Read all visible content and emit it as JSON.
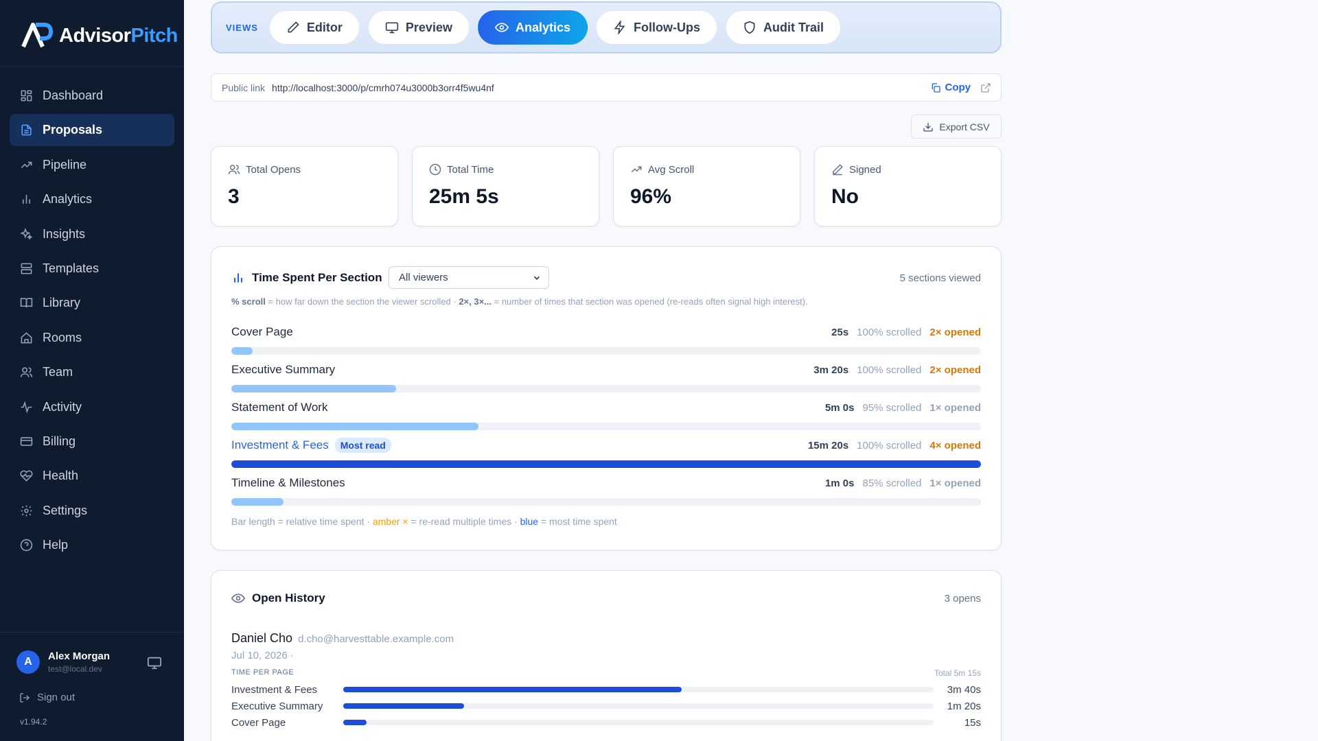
{
  "app": {
    "name_part1": "Advisor",
    "name_part2": "Pitch",
    "brand_color": "#3b9cff",
    "accent_color": "#2563eb"
  },
  "sidebar": {
    "items": [
      {
        "label": "Dashboard",
        "icon": "grid-icon",
        "active": false
      },
      {
        "label": "Proposals",
        "icon": "document-icon",
        "active": true
      },
      {
        "label": "Pipeline",
        "icon": "trending-icon",
        "active": false
      },
      {
        "label": "Analytics",
        "icon": "bar-chart-icon",
        "active": false
      },
      {
        "label": "Insights",
        "icon": "sparkles-icon",
        "active": false
      },
      {
        "label": "Templates",
        "icon": "layout-icon",
        "active": false
      },
      {
        "label": "Library",
        "icon": "book-icon",
        "active": false
      },
      {
        "label": "Rooms",
        "icon": "home-icon",
        "active": false
      },
      {
        "label": "Team",
        "icon": "users-icon",
        "active": false
      },
      {
        "label": "Activity",
        "icon": "pulse-icon",
        "active": false
      },
      {
        "label": "Billing",
        "icon": "credit-card-icon",
        "active": false
      },
      {
        "label": "Health",
        "icon": "heart-pulse-icon",
        "active": false
      },
      {
        "label": "Settings",
        "icon": "gear-icon",
        "active": false
      },
      {
        "label": "Help",
        "icon": "help-circle-icon",
        "active": false
      }
    ],
    "user": {
      "initial": "A",
      "name": "Alex Morgan",
      "email": "test@local.dev"
    },
    "sign_out": "Sign out",
    "version": "v1.94.2"
  },
  "views": {
    "label": "VIEWS",
    "tabs": [
      {
        "label": "Editor",
        "icon": "pencil-icon",
        "active": false
      },
      {
        "label": "Preview",
        "icon": "monitor-icon",
        "active": false
      },
      {
        "label": "Analytics",
        "icon": "eye-icon",
        "active": true
      },
      {
        "label": "Follow-Ups",
        "icon": "bolt-icon",
        "active": false
      },
      {
        "label": "Audit Trail",
        "icon": "shield-icon",
        "active": false
      }
    ]
  },
  "public_link": {
    "label": "Public link",
    "url": "http://localhost:3000/p/cmrh074u3000b3orr4f5wu4nf",
    "copy": "Copy"
  },
  "export_csv": "Export CSV",
  "stats": [
    {
      "label": "Total Opens",
      "value": "3",
      "icon": "users-icon"
    },
    {
      "label": "Total Time",
      "value": "25m 5s",
      "icon": "clock-icon"
    },
    {
      "label": "Avg Scroll",
      "value": "96%",
      "icon": "trending-icon"
    },
    {
      "label": "Signed",
      "value": "No",
      "icon": "pen-icon"
    }
  ],
  "time_per_section": {
    "title": "Time Spent Per Section",
    "filter": "All viewers",
    "meta": "5 sections viewed",
    "legend_scroll_key": "% scroll",
    "legend_scroll_text": " = how far down the section the viewer scrolled · ",
    "legend_reads_key": "2×, 3×...",
    "legend_reads_text": " = number of times that section was opened (re-reads often signal high interest).",
    "sections": [
      {
        "name": "Cover Page",
        "time": "25s",
        "scroll": "100% scrolled",
        "opened": "2× opened",
        "reread": true,
        "most_read": false,
        "fraction": 0.028
      },
      {
        "name": "Executive Summary",
        "time": "3m 20s",
        "scroll": "100% scrolled",
        "opened": "2× opened",
        "reread": true,
        "most_read": false,
        "fraction": 0.22
      },
      {
        "name": "Statement of Work",
        "time": "5m 0s",
        "scroll": "95% scrolled",
        "opened": "1× opened",
        "reread": false,
        "most_read": false,
        "fraction": 0.33
      },
      {
        "name": "Investment & Fees",
        "time": "15m 20s",
        "scroll": "100% scrolled",
        "opened": "4× opened",
        "reread": true,
        "most_read": true,
        "badge": "Most read",
        "fraction": 1.0
      },
      {
        "name": "Timeline & Milestones",
        "time": "1m 0s",
        "scroll": "85% scrolled",
        "opened": "1× opened",
        "reread": false,
        "most_read": false,
        "fraction": 0.07
      }
    ],
    "legend_bottom_1": "Bar length = relative time spent · ",
    "legend_bottom_amber": "amber ×",
    "legend_bottom_2": " = re-read multiple times · ",
    "legend_bottom_blue": "blue",
    "legend_bottom_3": " = most time spent"
  },
  "open_history": {
    "title": "Open History",
    "meta": "3 opens",
    "viewer": {
      "name": "Daniel Cho",
      "email": "d.cho@harvesttable.example.com",
      "date": "Jul 10, 2026 ·"
    },
    "time_per_page_label": "TIME PER PAGE",
    "total": "Total 5m 15s",
    "pages": [
      {
        "name": "Investment & Fees",
        "time": "3m 40s",
        "fraction": 0.573
      },
      {
        "name": "Executive Summary",
        "time": "1m 20s",
        "fraction": 0.205
      },
      {
        "name": "Cover Page",
        "time": "15s",
        "fraction": 0.04
      }
    ]
  }
}
